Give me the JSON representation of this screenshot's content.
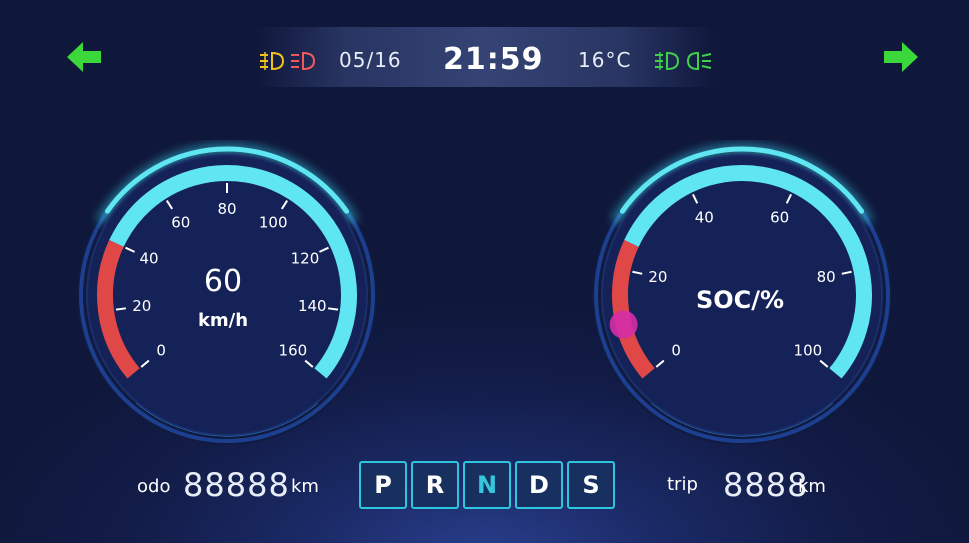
{
  "status_bar": {
    "date": "05/16",
    "time": "21:59",
    "temperature": "16°C",
    "left_indicators": [
      "fog-light-icon",
      "headlight-icon"
    ],
    "right_indicators": [
      "front-fog-light-icon",
      "low-beam-icon"
    ]
  },
  "turn_signals": {
    "left": "turn-left-arrow-icon",
    "right": "turn-right-arrow-icon"
  },
  "speedometer": {
    "value": "60",
    "unit": "km/h",
    "ticks": [
      "0",
      "20",
      "40",
      "60",
      "80",
      "100",
      "120",
      "140",
      "160"
    ],
    "max": 160,
    "red_zone_max": 40
  },
  "soc_gauge": {
    "label": "SOC/%",
    "ticks": [
      "0",
      "20",
      "40",
      "60",
      "80",
      "100"
    ],
    "max": 100,
    "red_zone_max": 25,
    "marker_value": 10
  },
  "odometer": {
    "label": "odo",
    "value": "88888",
    "unit": "km"
  },
  "trip": {
    "label": "trip",
    "value": "8888",
    "unit": "km"
  },
  "gears": {
    "items": [
      "P",
      "R",
      "N",
      "D",
      "S"
    ],
    "selected": "N"
  },
  "colors": {
    "accent_cyan": "#5fe6f2",
    "red_zone": "#e04848",
    "turn_signal_green": "#3ad83a",
    "indicator_yellow": "#f2c21b",
    "indicator_red": "#f05a5a",
    "indicator_green": "#3fd04a",
    "soc_marker": "#d52ea8"
  }
}
